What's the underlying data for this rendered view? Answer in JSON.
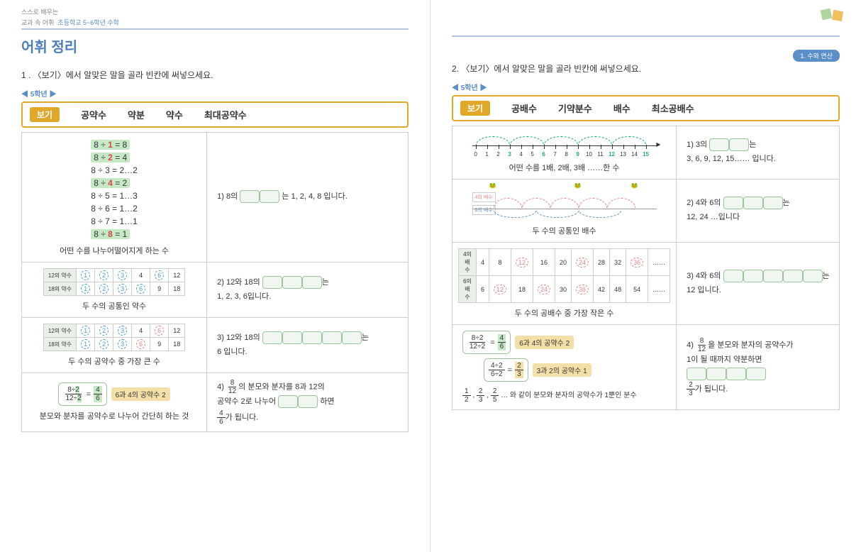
{
  "header": {
    "line1": "스스로 배우는",
    "line2": "교과 속 어휘",
    "subject": "초등학교 5~6학년 수학"
  },
  "titleMain": "어휘 정리",
  "unitBadge": "1. 수와 연산",
  "left": {
    "instr": "1 . 〈보기〉에서 알맞은 말을 골라 빈칸에 써넣으세요.",
    "grade": "◀ 5학년 ▶",
    "bogi": {
      "tag": "보기",
      "w1": "공약수",
      "w2": "약분",
      "w3": "약수",
      "w4": "최대공약수"
    },
    "r1": {
      "eq1": "8 ÷ 1 = 8",
      "eq2": "8 ÷ 2 = 4",
      "eq3": "8 ÷ 3 = 2…2",
      "eq4": "8 ÷ 4 = 2",
      "eq5": "8 ÷ 5 = 1…3",
      "eq6": "8 ÷ 6 = 1…2",
      "eq7": "8 ÷ 7 = 1…1",
      "eq8": "8 ÷ 8 = 1",
      "cap": "어떤 수를 나누어떨어지게 하는 수",
      "q": "1) 8의",
      "a": "는 1, 2, 4, 8 입니다."
    },
    "r2": {
      "th1": "12의 약수",
      "th2": "18의 약수",
      "cap": "두 수의 공통인 약수",
      "q": "2) 12와 18의",
      "a": "1, 2, 3, 6입니다.",
      "suf": "는"
    },
    "r3": {
      "cap": "두 수의 공약수 중 가장 큰 수",
      "q": "3) 12와 18의",
      "a": "6 입니다.",
      "suf": "는"
    },
    "r4": {
      "tag": "6과 4의 공약수 2",
      "cap": "분모와 분자를 공약수로 나누어 간단히 하는 것",
      "q1": "4)",
      "q2": "의 분모와 분자를 8과 12의",
      "q3": "공약수 2로 나누어",
      "q4": "하면",
      "q5": "가 됩니다."
    }
  },
  "right": {
    "instr": "2. 〈보기〉에서 알맞은 말을 골라 빈칸에 써넣으세요.",
    "grade": "◀ 5학년 ▶",
    "bogi": {
      "tag": "보기",
      "w1": "공배수",
      "w2": "기약분수",
      "w3": "배수",
      "w4": "최소공배수"
    },
    "r1": {
      "cap": "어떤 수를 1배, 2배, 3배 ……한 수",
      "q": "1) 3의",
      "a": "3, 6, 9, 12, 15…… 입니다.",
      "suf": "는"
    },
    "r2": {
      "leg1": "4의 배수",
      "leg2": "6의 배수",
      "cap": "두 수의 공통인 배수",
      "q": "2) 4와 6의",
      "a": "12, 24 …입니다",
      "suf": "는"
    },
    "r3": {
      "th1": "4의 배수",
      "th2": "6의 배수",
      "cap": "두 수의 공배수 중 가장 작은 수",
      "q": "3) 4와 6의",
      "a": "12 입니다.",
      "suf": "는"
    },
    "r4": {
      "tag1": "6과 4의 공약수 2",
      "tag2": "3과 2의 공약수 1",
      "cap": "… 와 같이 분모와 분자의 공약수가 1뿐인 분수",
      "q1": "4)",
      "q2": "을 분모와 분자의 공약수가",
      "q3": "1이 될 때까지 약분하면",
      "q4": "가 됩니다."
    }
  },
  "mini12": [
    "1",
    "2",
    "3",
    "4",
    "6",
    "12"
  ],
  "mini18": [
    "1",
    "2",
    "3",
    "6",
    "9",
    "18"
  ],
  "mult4": [
    "4",
    "8",
    "12",
    "16",
    "20",
    "24",
    "28",
    "32",
    "36",
    "……"
  ],
  "mult6": [
    "6",
    "12",
    "18",
    "24",
    "30",
    "36",
    "42",
    "48",
    "54",
    "……"
  ],
  "numline": [
    "0",
    "1",
    "2",
    "3",
    "4",
    "5",
    "6",
    "7",
    "8",
    "9",
    "10",
    "11",
    "12",
    "13",
    "14",
    "15"
  ]
}
